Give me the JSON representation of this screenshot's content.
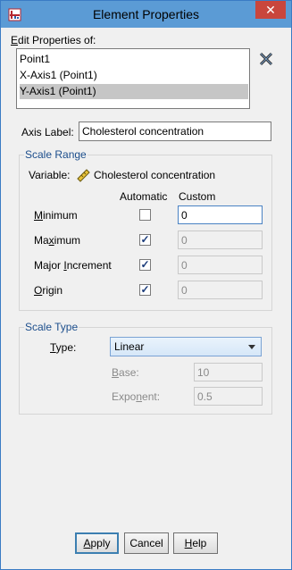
{
  "window": {
    "title": "Element Properties",
    "close_glyph": "✕"
  },
  "edit_properties": {
    "label_accel": "E",
    "label_rest": "dit Properties of:",
    "items": [
      "Point1",
      "X-Axis1 (Point1)",
      "Y-Axis1 (Point1)"
    ],
    "selected_index": 2
  },
  "axis_label": {
    "label": "Axis Label:",
    "value": "Cholesterol concentration"
  },
  "scale_range": {
    "legend": "Scale Range",
    "variable_label": "Variable:",
    "variable_name": "Cholesterol concentration",
    "col_automatic": "Automatic",
    "col_custom": "Custom",
    "rows": [
      {
        "accel": "M",
        "rest": "inimum",
        "automatic": false,
        "value": "0"
      },
      {
        "accel": "",
        "rest": "Maximum",
        "pre": "Ma",
        "accel_mid": "x",
        "post": "imum",
        "automatic": true,
        "value": "0"
      },
      {
        "pre": "Major ",
        "accel_mid": "I",
        "post": "ncrement",
        "automatic": true,
        "value": "0"
      },
      {
        "accel": "O",
        "rest": "rigin",
        "automatic": true,
        "value": "0"
      }
    ]
  },
  "scale_type": {
    "legend": "Scale Type",
    "type_accel": "T",
    "type_rest": "ype:",
    "type_value": "Linear",
    "base_accel": "B",
    "base_rest": "ase:",
    "base_value": "10",
    "exponent_pre": "Expo",
    "exponent_accel": "n",
    "exponent_post": "ent:",
    "exponent_value": "0.5"
  },
  "buttons": {
    "apply_accel": "A",
    "apply_rest": "pply",
    "cancel": "Cancel",
    "help_accel": "H",
    "help_rest": "elp"
  },
  "icons": {
    "app": "spss-chart-icon",
    "delete": "delete-x-icon",
    "variable": "ruler-scale-icon"
  }
}
